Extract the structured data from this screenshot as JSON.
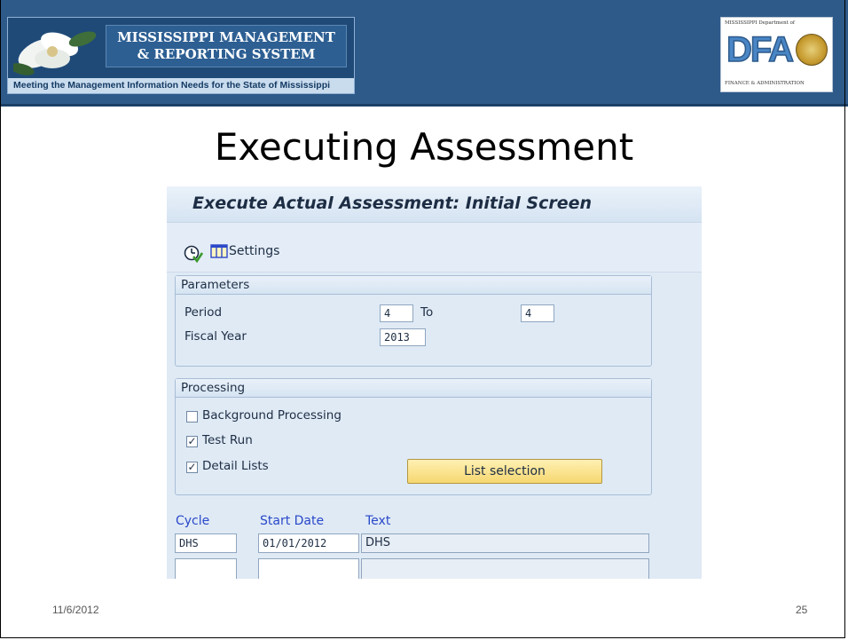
{
  "header": {
    "logo_title_line1": "MISSISSIPPI MANAGEMENT",
    "logo_title_line2": "& REPORTING SYSTEM",
    "logo_tagline": "Meeting the Management Information Needs for the State of Mississippi",
    "dfa_dept": "MISSISSIPPI Department of",
    "dfa_letters": "DFA",
    "dfa_sub": "FINANCE & ADMINISTRATION"
  },
  "slide": {
    "title": "Executing Assessment",
    "date": "11/6/2012",
    "page_number": "25"
  },
  "sap": {
    "screen_title": "Execute Actual Assessment: Initial Screen",
    "toolbar": {
      "execute_icon": "execute-icon",
      "settings_icon": "layout-icon",
      "settings_label": "Settings"
    },
    "parameters": {
      "header": "Parameters",
      "period_label": "Period",
      "period_from": "4",
      "to_label": "To",
      "period_to": "4",
      "fiscal_year_label": "Fiscal Year",
      "fiscal_year": "2013"
    },
    "processing": {
      "header": "Processing",
      "background_label": "Background Processing",
      "background_checked": false,
      "test_run_label": "Test Run",
      "test_run_checked": true,
      "detail_lists_label": "Detail Lists",
      "detail_lists_checked": true,
      "list_selection_label": "List selection"
    },
    "cycle_table": {
      "headers": [
        "Cycle",
        "Start Date",
        "Text"
      ],
      "rows": [
        [
          "DHS",
          "01/01/2012",
          "DHS"
        ],
        [
          "",
          "",
          ""
        ]
      ]
    },
    "colors": {
      "header_band": "#2e5a8a",
      "sap_background": "#dfeaf5",
      "button_yellow": "#f6d770",
      "column_header_blue": "#2a48c9"
    }
  }
}
